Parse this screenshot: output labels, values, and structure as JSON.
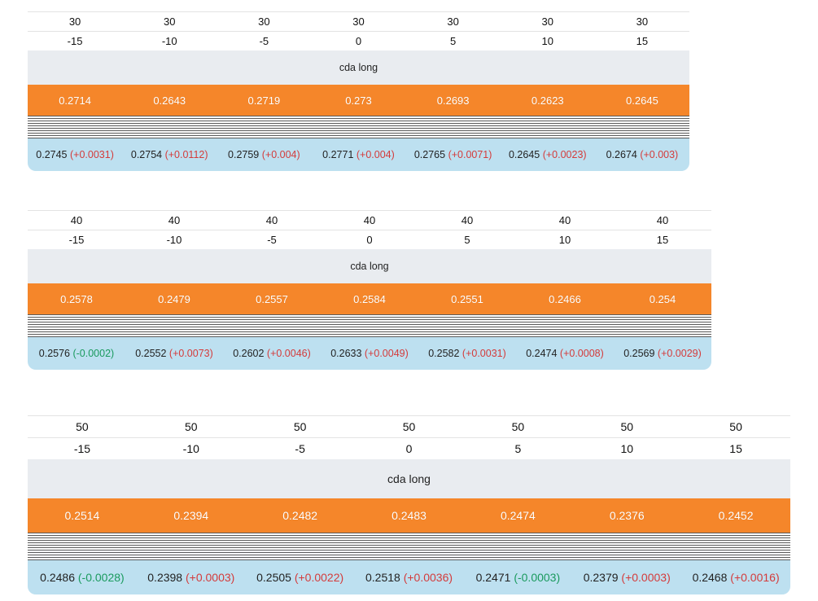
{
  "tables": [
    {
      "speed": [
        "30",
        "30",
        "30",
        "30",
        "30",
        "30",
        "30"
      ],
      "angles": [
        "-15",
        "-10",
        "-5",
        "0",
        "5",
        "10",
        "15"
      ],
      "label": "cda long",
      "base": [
        "0.2714",
        "0.2643",
        "0.2719",
        "0.273",
        "0.2693",
        "0.2623",
        "0.2645"
      ],
      "compare": [
        {
          "value": "0.2745",
          "delta": "(+0.0031)",
          "dir": "up"
        },
        {
          "value": "0.2754",
          "delta": "(+0.0112)",
          "dir": "up"
        },
        {
          "value": "0.2759",
          "delta": "(+0.004)",
          "dir": "up"
        },
        {
          "value": "0.2771",
          "delta": "(+0.004)",
          "dir": "up"
        },
        {
          "value": "0.2765",
          "delta": "(+0.0071)",
          "dir": "up"
        },
        {
          "value": "0.2645",
          "delta": "(+0.0023)",
          "dir": "up"
        },
        {
          "value": "0.2674",
          "delta": "(+0.003)",
          "dir": "up"
        }
      ]
    },
    {
      "speed": [
        "40",
        "40",
        "40",
        "40",
        "40",
        "40",
        "40"
      ],
      "angles": [
        "-15",
        "-10",
        "-5",
        "0",
        "5",
        "10",
        "15"
      ],
      "label": "cda long",
      "base": [
        "0.2578",
        "0.2479",
        "0.2557",
        "0.2584",
        "0.2551",
        "0.2466",
        "0.254"
      ],
      "compare": [
        {
          "value": "0.2576",
          "delta": "(-0.0002)",
          "dir": "down"
        },
        {
          "value": "0.2552",
          "delta": "(+0.0073)",
          "dir": "up"
        },
        {
          "value": "0.2602",
          "delta": "(+0.0046)",
          "dir": "up"
        },
        {
          "value": "0.2633",
          "delta": "(+0.0049)",
          "dir": "up"
        },
        {
          "value": "0.2582",
          "delta": "(+0.0031)",
          "dir": "up"
        },
        {
          "value": "0.2474",
          "delta": "(+0.0008)",
          "dir": "up"
        },
        {
          "value": "0.2569",
          "delta": "(+0.0029)",
          "dir": "up"
        }
      ]
    },
    {
      "speed": [
        "50",
        "50",
        "50",
        "50",
        "50",
        "50",
        "50"
      ],
      "angles": [
        "-15",
        "-10",
        "-5",
        "0",
        "5",
        "10",
        "15"
      ],
      "label": "cda long",
      "base": [
        "0.2514",
        "0.2394",
        "0.2482",
        "0.2483",
        "0.2474",
        "0.2376",
        "0.2452"
      ],
      "compare": [
        {
          "value": "0.2486",
          "delta": "(-0.0028)",
          "dir": "down"
        },
        {
          "value": "0.2398",
          "delta": "(+0.0003)",
          "dir": "up"
        },
        {
          "value": "0.2505",
          "delta": "(+0.0022)",
          "dir": "up"
        },
        {
          "value": "0.2518",
          "delta": "(+0.0036)",
          "dir": "up"
        },
        {
          "value": "0.2471",
          "delta": "(-0.0003)",
          "dir": "down"
        },
        {
          "value": "0.2379",
          "delta": "(+0.0003)",
          "dir": "up"
        },
        {
          "value": "0.2468",
          "delta": "(+0.0016)",
          "dir": "up"
        }
      ]
    }
  ],
  "colors": {
    "orange": "#f5862a",
    "blue": "#bde0f0",
    "label_bg": "#e9ecf0",
    "delta_up": "#d43b3b",
    "delta_down": "#1a9a5e"
  }
}
